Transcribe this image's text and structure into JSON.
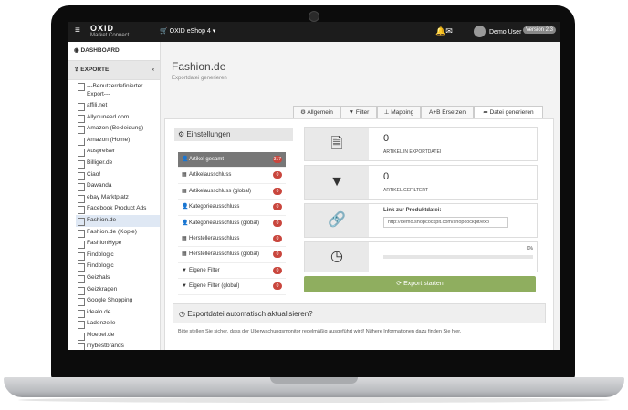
{
  "topbar": {
    "logo_line1": "OXID",
    "logo_line2": "Market Connect",
    "shop": "OXID eShop 4",
    "user": "Demo User",
    "version": "Version 2.3"
  },
  "sidebar": {
    "dashboard": "DASHBOARD",
    "exporte": "EXPORTE",
    "items": [
      "---Benutzerdefinierter Export---",
      "affili.net",
      "Allyouneed.com",
      "Amazon (Bekleidung)",
      "Amazon (Home)",
      "Auspreiser",
      "Billiger.de",
      "Ciao!",
      "Dawanda",
      "ebay Marktplatz",
      "Facebook Product Ads",
      "Fashion.de",
      "Fashion.de (Kopie)",
      "FashionHype",
      "Findologic",
      "Findologic",
      "Geizhals",
      "Geizkragen",
      "Google Shopping",
      "idealo.de",
      "Ladenzeile",
      "Moebel.de",
      "mybestbrands"
    ]
  },
  "page": {
    "title": "Fashion.de",
    "subtitle": "Exportdatei generieren"
  },
  "tabs": [
    "Allgemein",
    "Filter",
    "Mapping",
    "A+B Ersetzen",
    "Datei generieren"
  ],
  "settings": {
    "heading": "Einstellungen",
    "items": [
      {
        "label": "Artikel gesamt",
        "count": "317",
        "icon": "user-icon"
      },
      {
        "label": "Artikelausschluss",
        "count": "0",
        "icon": "calendar-icon"
      },
      {
        "label": "Artikelausschluss (global)",
        "count": "0",
        "icon": "calendar-icon"
      },
      {
        "label": "Kategorieausschluss",
        "count": "0",
        "icon": "user-icon"
      },
      {
        "label": "Kategorieausschluss (global)",
        "count": "0",
        "icon": "user-icon"
      },
      {
        "label": "Herstellerausschluss",
        "count": "0",
        "icon": "calendar-icon"
      },
      {
        "label": "Herstellerausschluss (global)",
        "count": "0",
        "icon": "calendar-icon"
      },
      {
        "label": "Eigene Filter",
        "count": "0",
        "icon": "filter-icon"
      },
      {
        "label": "Eigene Filter (global)",
        "count": "0",
        "icon": "filter-icon"
      }
    ]
  },
  "stats": {
    "exported_count": "0",
    "exported_label": "ARTIKEL IN EXPORTDATEI",
    "filtered_count": "0",
    "filtered_label": "ARTIKEL GEFILTERT",
    "link_label": "Link zur Produktdatei:",
    "link_value": "http://demo.shopcockpit.com/shopcockpit/exp",
    "progress_label": "0%",
    "progress": 0
  },
  "export_button": "Export starten",
  "auto": {
    "heading": "Exportdatei automatisch aktualisieren?",
    "text": "Bitte stellen Sie sicher, dass der Überwachungsmonitor regelmäßig ausgeführt wird! Nähere Informationen dazu finden Sie hier."
  },
  "colors": {
    "accent_green": "#8fae5f",
    "badge_red": "#c9463d",
    "topbar": "#1c1c1c"
  }
}
